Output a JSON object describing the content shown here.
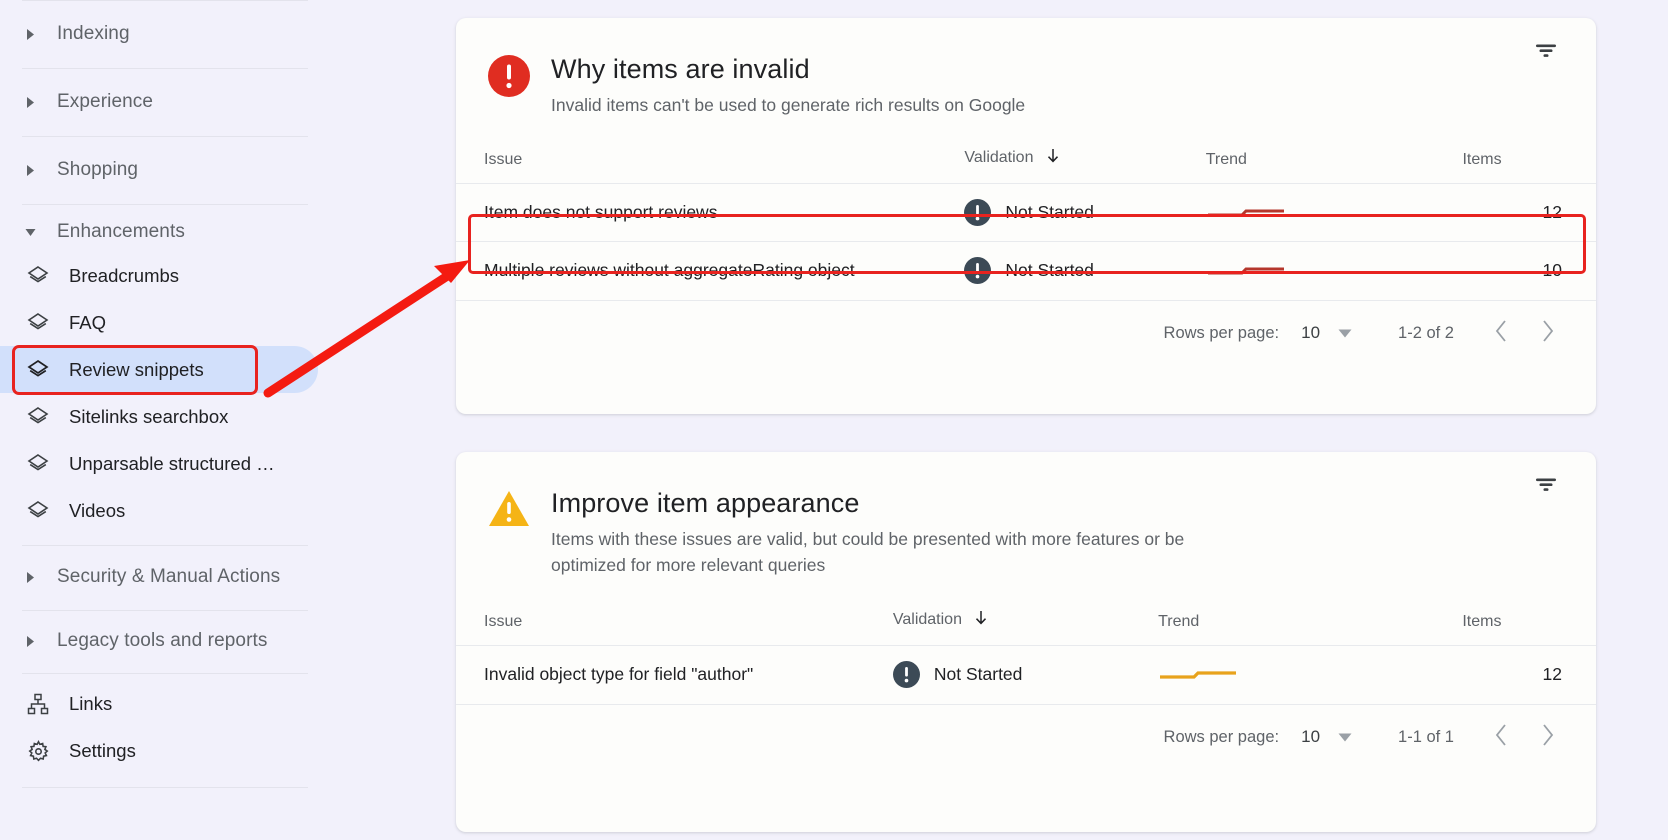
{
  "sidebar": {
    "groups": [
      {
        "label": "Indexing",
        "expanded": false,
        "icon": "chevron-right-icon"
      },
      {
        "label": "Experience",
        "expanded": false,
        "icon": "chevron-right-icon"
      },
      {
        "label": "Shopping",
        "expanded": false,
        "icon": "chevron-right-icon"
      },
      {
        "label": "Enhancements",
        "expanded": true,
        "icon": "chevron-down-icon"
      },
      {
        "label": "Security & Manual Actions",
        "expanded": false,
        "icon": "chevron-right-icon"
      },
      {
        "label": "Legacy tools and reports",
        "expanded": false,
        "icon": "chevron-right-icon"
      }
    ],
    "enhancement_items": [
      {
        "label": "Breadcrumbs",
        "icon": "layers-icon",
        "selected": false
      },
      {
        "label": "FAQ",
        "icon": "layers-icon",
        "selected": false
      },
      {
        "label": "Review snippets",
        "icon": "layers-icon",
        "selected": true
      },
      {
        "label": "Sitelinks searchbox",
        "icon": "layers-icon",
        "selected": false
      },
      {
        "label": "Unparsable structured …",
        "icon": "layers-icon",
        "selected": false
      },
      {
        "label": "Videos",
        "icon": "layers-icon",
        "selected": false
      }
    ],
    "bottom_items": [
      {
        "label": "Links",
        "icon": "links-sitemap-icon"
      },
      {
        "label": "Settings",
        "icon": "gear-icon"
      }
    ]
  },
  "cards": [
    {
      "id": "invalid",
      "severity": "error",
      "severity_icon": "error-circle-icon",
      "accent_color": "#e02d21",
      "title": "Why items are invalid",
      "subtitle": "Invalid items can't be used to generate rich results on Google",
      "filter_icon": "filter-icon",
      "columns": [
        "Issue",
        "Validation",
        "Trend",
        "Items"
      ],
      "sorted_column": "Validation",
      "sort_direction": "down",
      "rows": [
        {
          "issue": "Item does not support reviews",
          "validation": "Not Started",
          "validation_icon": "exclamation-circle-icon",
          "trend_color": "#b5372c",
          "items": "12",
          "highlighted": true
        },
        {
          "issue": "Multiple reviews without aggregateRating object",
          "validation": "Not Started",
          "validation_icon": "exclamation-circle-icon",
          "trend_color": "#b5372c",
          "items": "10",
          "highlighted": false
        }
      ],
      "pagination": {
        "rows_per_page_label": "Rows per page:",
        "rows_per_page_value": "10",
        "range": "1-2 of 2",
        "prev_icon": "chevron-left-icon",
        "next_icon": "chevron-right-icon",
        "dropdown_icon": "triangle-down-icon"
      }
    },
    {
      "id": "improve",
      "severity": "warning",
      "severity_icon": "warning-triangle-icon",
      "accent_color": "#f5b416",
      "title": "Improve item appearance",
      "subtitle": "Items with these issues are valid, but could be presented with more features or be optimized for more relevant queries",
      "filter_icon": "filter-icon",
      "columns": [
        "Issue",
        "Validation",
        "Trend",
        "Items"
      ],
      "sorted_column": "Validation",
      "sort_direction": "down",
      "rows": [
        {
          "issue": "Invalid object type for field \"author\"",
          "validation": "Not Started",
          "validation_icon": "exclamation-circle-icon",
          "trend_color": "#e8a31c",
          "items": "12",
          "highlighted": false
        }
      ],
      "pagination": {
        "rows_per_page_label": "Rows per page:",
        "rows_per_page_value": "10",
        "range": "1-1 of 1",
        "prev_icon": "chevron-left-icon",
        "next_icon": "chevron-right-icon",
        "dropdown_icon": "triangle-down-icon"
      }
    }
  ],
  "annotations": {
    "highlight_color": "#e8231f",
    "arrow_color": "#f41b11",
    "arrow_from": "Review snippets sidebar item",
    "arrow_to": "Item does not support reviews row"
  }
}
